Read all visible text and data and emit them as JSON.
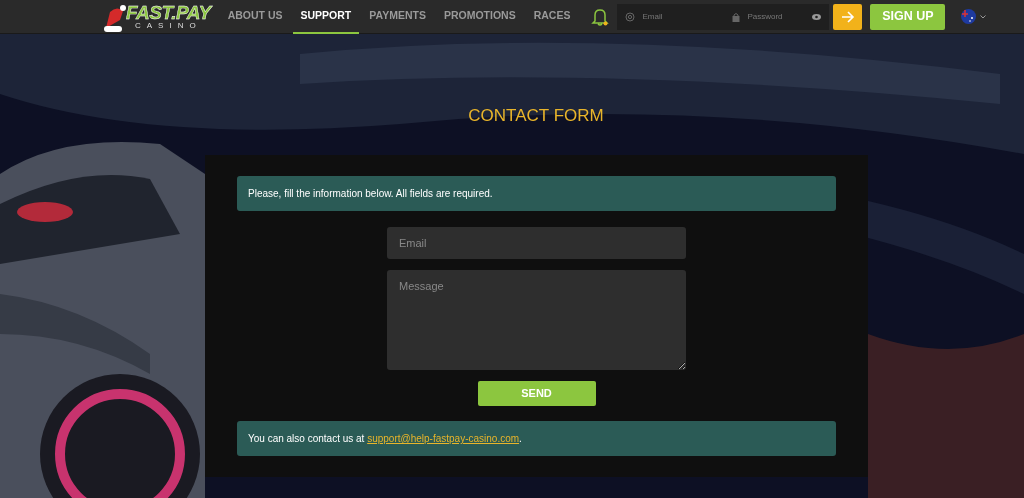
{
  "logo": {
    "title": "FAST.PAY",
    "subtitle": "CASINO"
  },
  "nav": [
    {
      "label": "ABOUT US",
      "selected": false
    },
    {
      "label": "SUPPORT",
      "selected": true
    },
    {
      "label": "PAYMENTS",
      "selected": false
    },
    {
      "label": "PROMOTIONS",
      "selected": false
    },
    {
      "label": "RACES",
      "selected": false
    }
  ],
  "login": {
    "email_placeholder": "Email",
    "password_placeholder": "Password"
  },
  "signup": "SIGN UP",
  "page_title": "CONTACT FORM",
  "info": "Please, fill the information below. All fields are required.",
  "form": {
    "email_placeholder": "Email",
    "message_placeholder": "Message",
    "submit": "SEND"
  },
  "contact": {
    "text": "You can also contact us at ",
    "link": "support@help-fastpay-casino.com",
    "end": "."
  }
}
